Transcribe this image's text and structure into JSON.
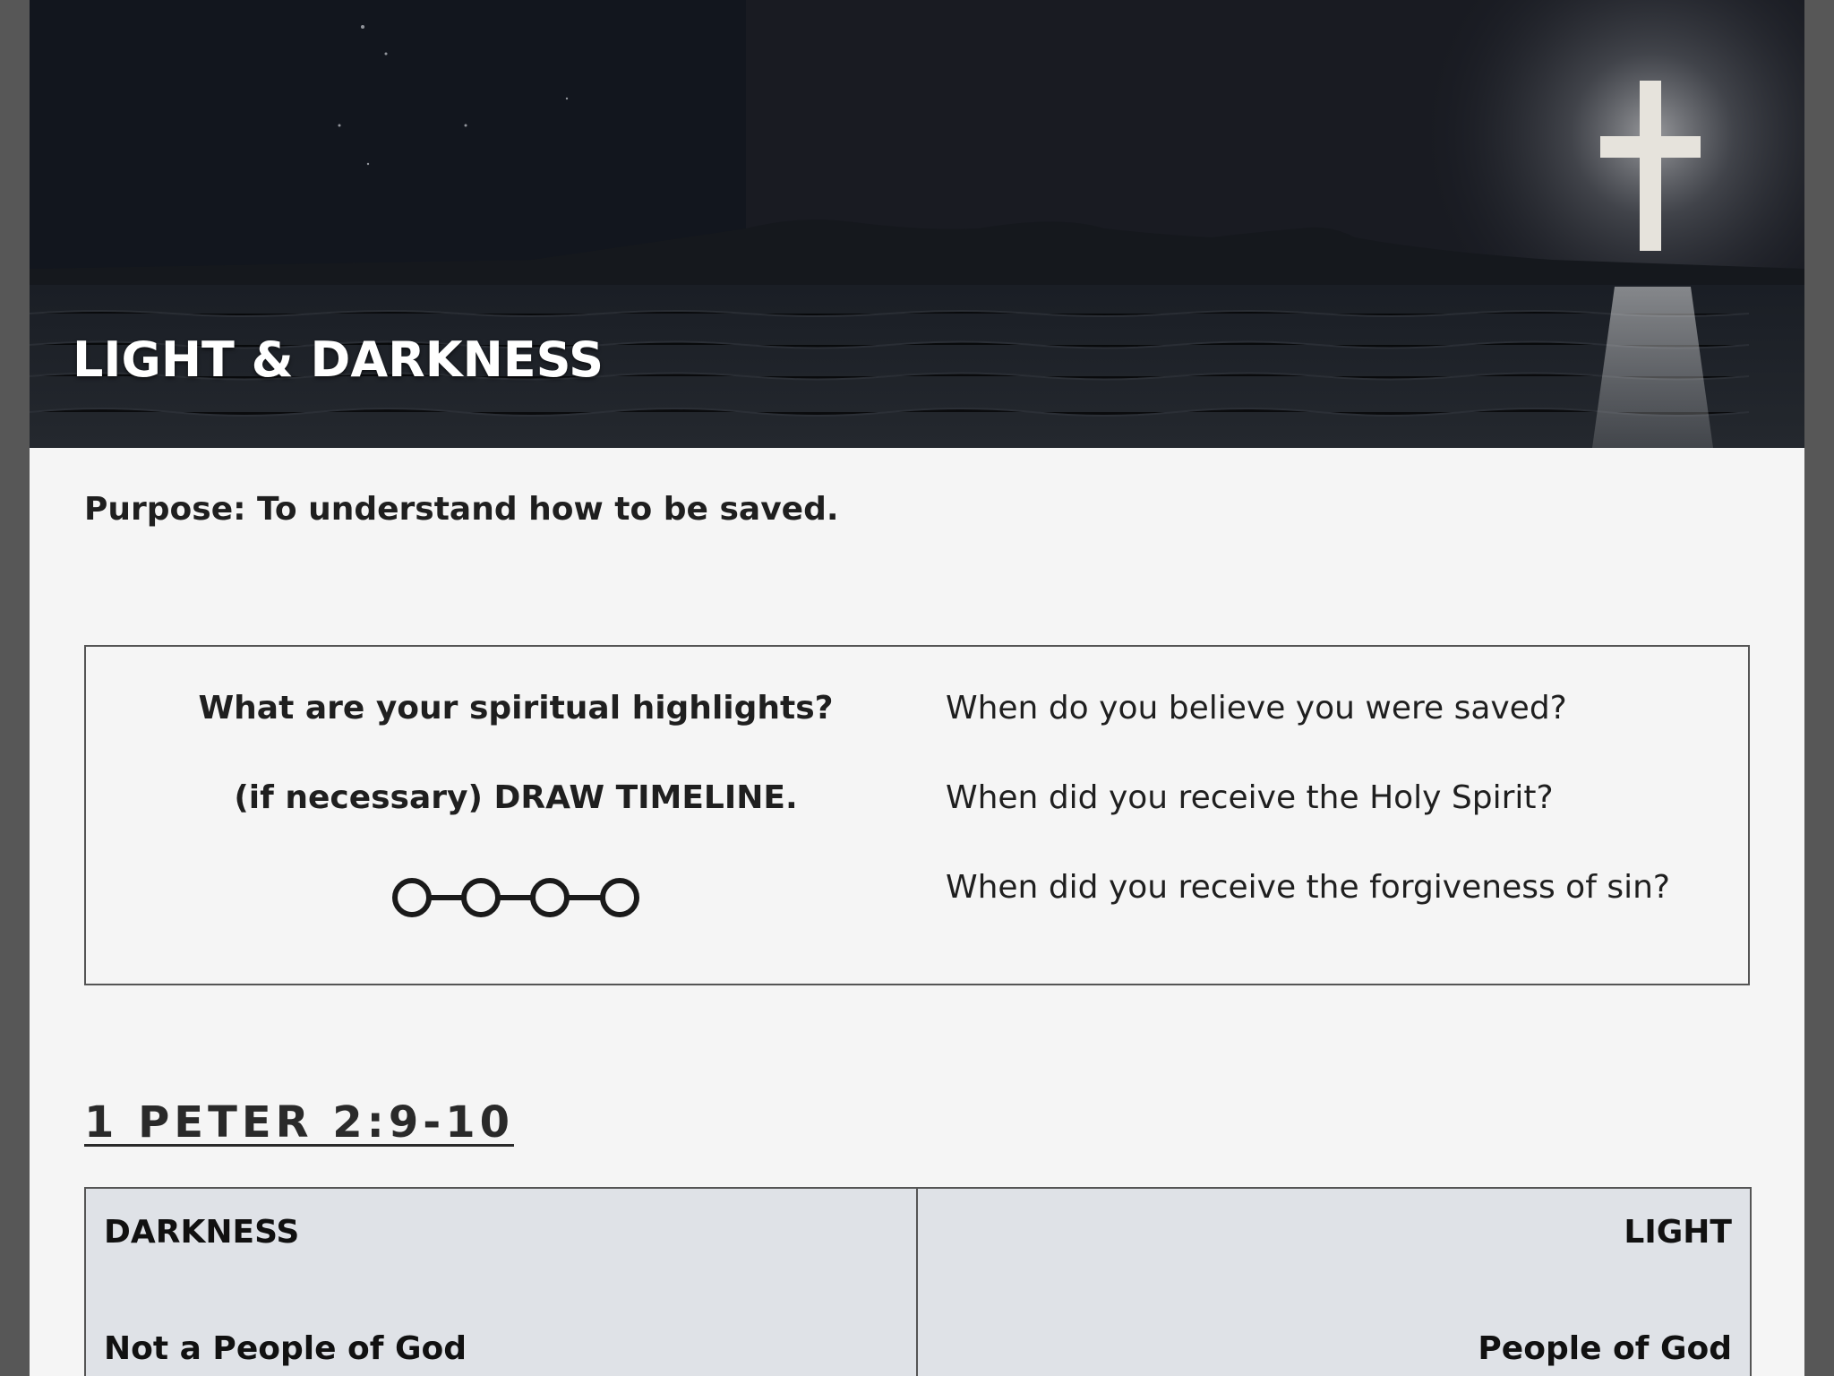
{
  "hero": {
    "title": "LIGHT & DARKNESS"
  },
  "purpose": "Purpose: To understand how to be saved.",
  "prompt_box": {
    "left": {
      "heading": "What are your spiritual highlights?",
      "instruction": "(if necessary) DRAW TIMELINE."
    },
    "questions": [
      "When do you believe you were saved?",
      "When did you receive the Holy Spirit?",
      "When did you receive the forgiveness of sin?"
    ]
  },
  "scripture_ref": "1 PETER 2:9-10",
  "comparison_table": {
    "left_header": "DARKNESS",
    "right_header": "LIGHT",
    "rows": [
      {
        "left": "Not a People of God",
        "right": "People of God"
      }
    ]
  },
  "colors": {
    "page_background": "#f5f5f5",
    "frame": "#575757",
    "table_background": "#dfe2e7"
  },
  "icons": [
    "cross-image",
    "timeline-icon"
  ]
}
